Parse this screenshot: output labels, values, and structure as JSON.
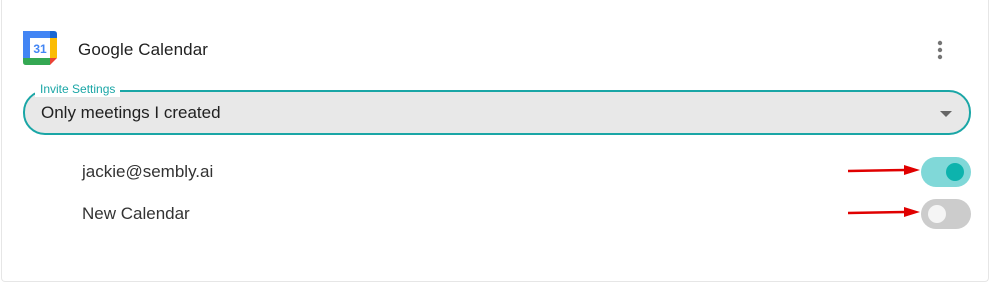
{
  "integration": {
    "name": "Google Calendar",
    "logo_icon": "google-calendar-icon",
    "logo_day": "31",
    "more_icon": "more-vertical-icon"
  },
  "invite_settings": {
    "label": "Invite Settings",
    "selected": "Only meetings I created"
  },
  "calendars": [
    {
      "label": "jackie@sembly.ai",
      "enabled": true
    },
    {
      "label": "New Calendar",
      "enabled": false
    }
  ],
  "colors": {
    "accent": "#1aa6a6",
    "toggle_on_track": "#80d8d8",
    "toggle_on_knob": "#0db3ad",
    "annotation_arrow": "#e00000"
  }
}
